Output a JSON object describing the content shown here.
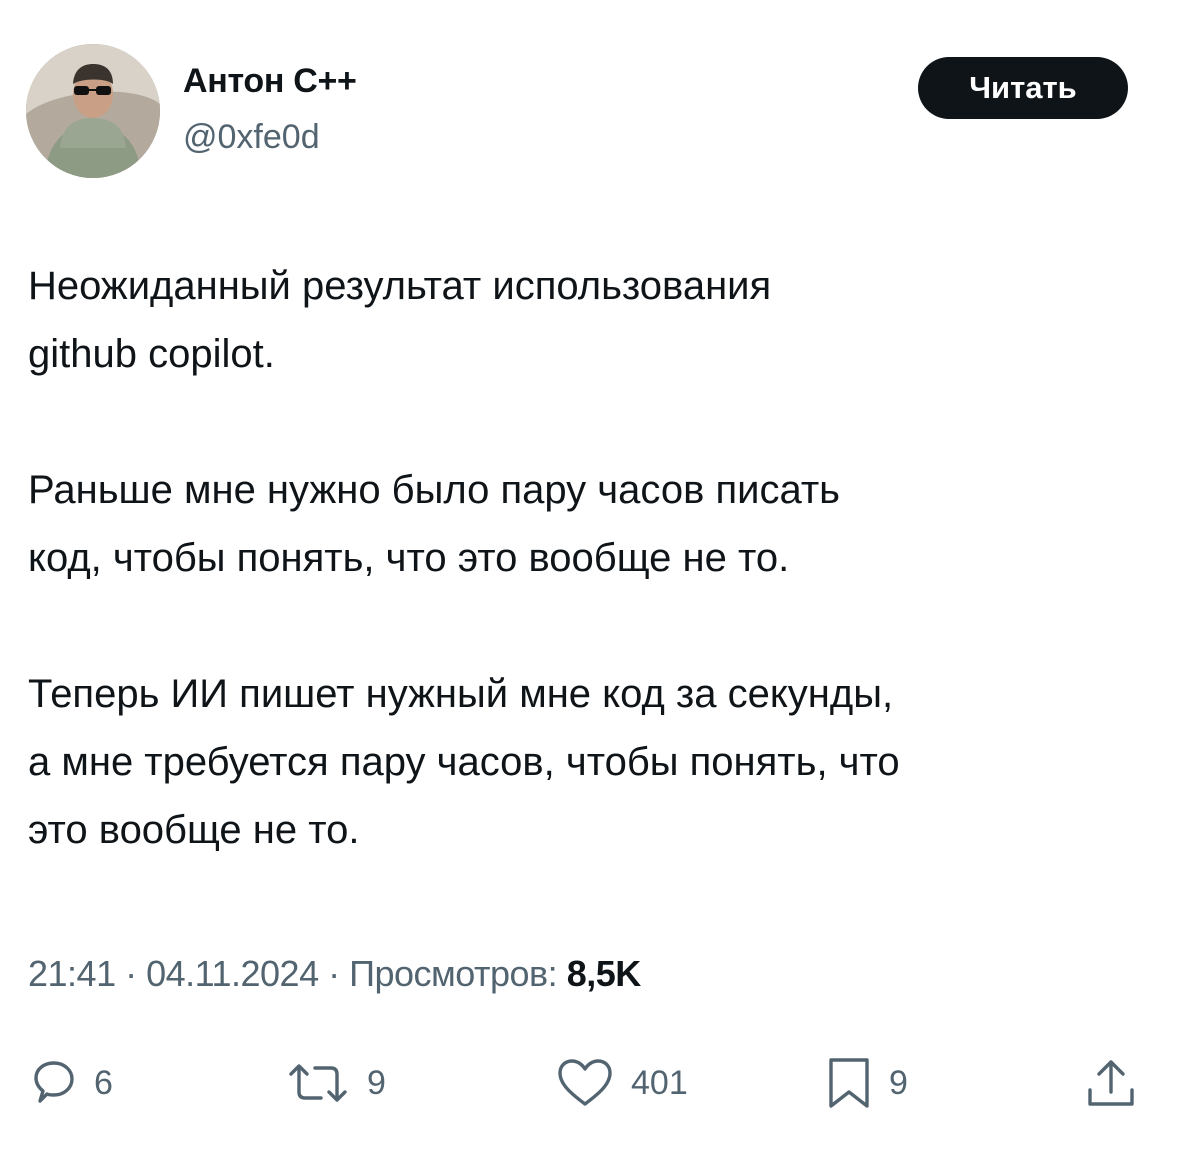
{
  "author": {
    "display_name": "Антон С++",
    "handle": "@0xfe0d"
  },
  "follow_button": {
    "label": "Читать"
  },
  "tweet": {
    "text": "Неожиданный результат использования\ngithub copilot.\n\nРаньше мне нужно было пару часов писать\nкод, чтобы понять, что это вообще не то.\n\nТеперь ИИ пишет нужный мне код за секунды,\nа мне требуется пару часов, чтобы понять, что\nэто вообще не то.",
    "time": "21:41",
    "date": "04.11.2024",
    "views_label": "Просмотров:",
    "views": "8,5K",
    "separator": " · "
  },
  "actions": {
    "replies": {
      "icon": "reply-icon",
      "count": "6"
    },
    "reposts": {
      "icon": "repost-icon",
      "count": "9"
    },
    "likes": {
      "icon": "heart-icon",
      "count": "401"
    },
    "bookmarks": {
      "icon": "bookmark-icon",
      "count": "9"
    },
    "share": {
      "icon": "share-icon"
    }
  },
  "colors": {
    "text_primary": "#0f1419",
    "text_secondary": "#536471",
    "button_bg": "#0f1419",
    "background": "#ffffff"
  }
}
